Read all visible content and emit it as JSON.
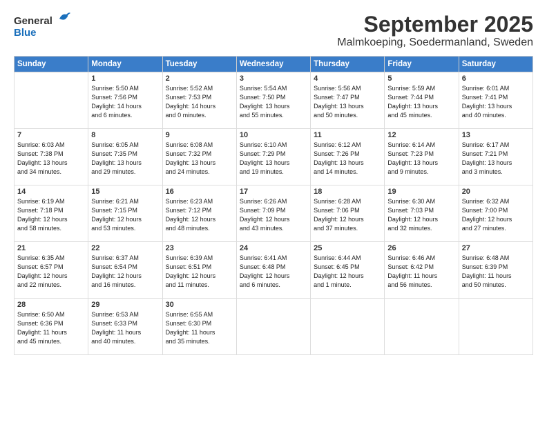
{
  "logo": {
    "general": "General",
    "blue": "Blue"
  },
  "title": "September 2025",
  "subtitle": "Malmkoeping, Soedermanland, Sweden",
  "headers": [
    "Sunday",
    "Monday",
    "Tuesday",
    "Wednesday",
    "Thursday",
    "Friday",
    "Saturday"
  ],
  "weeks": [
    [
      {
        "day": "",
        "info": ""
      },
      {
        "day": "1",
        "info": "Sunrise: 5:50 AM\nSunset: 7:56 PM\nDaylight: 14 hours\nand 6 minutes."
      },
      {
        "day": "2",
        "info": "Sunrise: 5:52 AM\nSunset: 7:53 PM\nDaylight: 14 hours\nand 0 minutes."
      },
      {
        "day": "3",
        "info": "Sunrise: 5:54 AM\nSunset: 7:50 PM\nDaylight: 13 hours\nand 55 minutes."
      },
      {
        "day": "4",
        "info": "Sunrise: 5:56 AM\nSunset: 7:47 PM\nDaylight: 13 hours\nand 50 minutes."
      },
      {
        "day": "5",
        "info": "Sunrise: 5:59 AM\nSunset: 7:44 PM\nDaylight: 13 hours\nand 45 minutes."
      },
      {
        "day": "6",
        "info": "Sunrise: 6:01 AM\nSunset: 7:41 PM\nDaylight: 13 hours\nand 40 minutes."
      }
    ],
    [
      {
        "day": "7",
        "info": "Sunrise: 6:03 AM\nSunset: 7:38 PM\nDaylight: 13 hours\nand 34 minutes."
      },
      {
        "day": "8",
        "info": "Sunrise: 6:05 AM\nSunset: 7:35 PM\nDaylight: 13 hours\nand 29 minutes."
      },
      {
        "day": "9",
        "info": "Sunrise: 6:08 AM\nSunset: 7:32 PM\nDaylight: 13 hours\nand 24 minutes."
      },
      {
        "day": "10",
        "info": "Sunrise: 6:10 AM\nSunset: 7:29 PM\nDaylight: 13 hours\nand 19 minutes."
      },
      {
        "day": "11",
        "info": "Sunrise: 6:12 AM\nSunset: 7:26 PM\nDaylight: 13 hours\nand 14 minutes."
      },
      {
        "day": "12",
        "info": "Sunrise: 6:14 AM\nSunset: 7:23 PM\nDaylight: 13 hours\nand 9 minutes."
      },
      {
        "day": "13",
        "info": "Sunrise: 6:17 AM\nSunset: 7:21 PM\nDaylight: 13 hours\nand 3 minutes."
      }
    ],
    [
      {
        "day": "14",
        "info": "Sunrise: 6:19 AM\nSunset: 7:18 PM\nDaylight: 12 hours\nand 58 minutes."
      },
      {
        "day": "15",
        "info": "Sunrise: 6:21 AM\nSunset: 7:15 PM\nDaylight: 12 hours\nand 53 minutes."
      },
      {
        "day": "16",
        "info": "Sunrise: 6:23 AM\nSunset: 7:12 PM\nDaylight: 12 hours\nand 48 minutes."
      },
      {
        "day": "17",
        "info": "Sunrise: 6:26 AM\nSunset: 7:09 PM\nDaylight: 12 hours\nand 43 minutes."
      },
      {
        "day": "18",
        "info": "Sunrise: 6:28 AM\nSunset: 7:06 PM\nDaylight: 12 hours\nand 37 minutes."
      },
      {
        "day": "19",
        "info": "Sunrise: 6:30 AM\nSunset: 7:03 PM\nDaylight: 12 hours\nand 32 minutes."
      },
      {
        "day": "20",
        "info": "Sunrise: 6:32 AM\nSunset: 7:00 PM\nDaylight: 12 hours\nand 27 minutes."
      }
    ],
    [
      {
        "day": "21",
        "info": "Sunrise: 6:35 AM\nSunset: 6:57 PM\nDaylight: 12 hours\nand 22 minutes."
      },
      {
        "day": "22",
        "info": "Sunrise: 6:37 AM\nSunset: 6:54 PM\nDaylight: 12 hours\nand 16 minutes."
      },
      {
        "day": "23",
        "info": "Sunrise: 6:39 AM\nSunset: 6:51 PM\nDaylight: 12 hours\nand 11 minutes."
      },
      {
        "day": "24",
        "info": "Sunrise: 6:41 AM\nSunset: 6:48 PM\nDaylight: 12 hours\nand 6 minutes."
      },
      {
        "day": "25",
        "info": "Sunrise: 6:44 AM\nSunset: 6:45 PM\nDaylight: 12 hours\nand 1 minute."
      },
      {
        "day": "26",
        "info": "Sunrise: 6:46 AM\nSunset: 6:42 PM\nDaylight: 11 hours\nand 56 minutes."
      },
      {
        "day": "27",
        "info": "Sunrise: 6:48 AM\nSunset: 6:39 PM\nDaylight: 11 hours\nand 50 minutes."
      }
    ],
    [
      {
        "day": "28",
        "info": "Sunrise: 6:50 AM\nSunset: 6:36 PM\nDaylight: 11 hours\nand 45 minutes."
      },
      {
        "day": "29",
        "info": "Sunrise: 6:53 AM\nSunset: 6:33 PM\nDaylight: 11 hours\nand 40 minutes."
      },
      {
        "day": "30",
        "info": "Sunrise: 6:55 AM\nSunset: 6:30 PM\nDaylight: 11 hours\nand 35 minutes."
      },
      {
        "day": "",
        "info": ""
      },
      {
        "day": "",
        "info": ""
      },
      {
        "day": "",
        "info": ""
      },
      {
        "day": "",
        "info": ""
      }
    ]
  ]
}
